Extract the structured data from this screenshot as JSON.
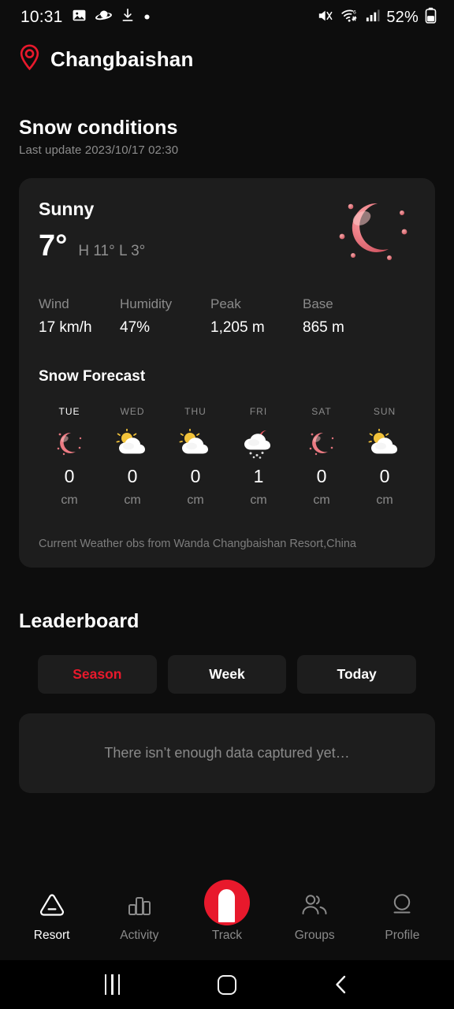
{
  "statusbar": {
    "time": "10:31",
    "battery_percent": "52%",
    "left_icons": [
      "image-icon",
      "saturn-icon",
      "download-icon",
      "dot-icon"
    ],
    "right_icons": [
      "mute-icon",
      "wifi-icon",
      "signal-icon",
      "battery-icon"
    ]
  },
  "header": {
    "location": "Changbaishan",
    "pin_icon": "location-pin-icon"
  },
  "snow": {
    "title": "Snow conditions",
    "last_update": "Last update 2023/10/17 02:30",
    "condition": "Sunny",
    "temperature": "7°",
    "high_low": "H 11°  L 3°",
    "weather_icon": "crescent-moon-icon",
    "stats": [
      {
        "label": "Wind",
        "value": "17 km/h"
      },
      {
        "label": "Humidity",
        "value": "47%"
      },
      {
        "label": "Peak",
        "value": "1,205 m"
      },
      {
        "label": "Base",
        "value": "865 m"
      }
    ],
    "forecast_title": "Snow Forecast",
    "forecast": [
      {
        "day": "TUE",
        "icon": "moon-icon",
        "value": "0",
        "unit": "cm",
        "active": true
      },
      {
        "day": "WED",
        "icon": "sun-cloud-icon",
        "value": "0",
        "unit": "cm",
        "active": false
      },
      {
        "day": "THU",
        "icon": "sun-cloud-icon",
        "value": "0",
        "unit": "cm",
        "active": false
      },
      {
        "day": "FRI",
        "icon": "snow-cloud-icon",
        "value": "1",
        "unit": "cm",
        "active": false
      },
      {
        "day": "SAT",
        "icon": "moon-icon",
        "value": "0",
        "unit": "cm",
        "active": false
      },
      {
        "day": "SUN",
        "icon": "sun-cloud-icon",
        "value": "0",
        "unit": "cm",
        "active": false
      }
    ],
    "obs_note": "Current Weather obs from Wanda Changbaishan Resort,China"
  },
  "leaderboard": {
    "title": "Leaderboard",
    "tabs": [
      {
        "label": "Season",
        "active": true
      },
      {
        "label": "Week",
        "active": false
      },
      {
        "label": "Today",
        "active": false
      }
    ],
    "empty_text": "There isn’t enough data captured yet…"
  },
  "bottomnav": [
    {
      "label": "Resort",
      "icon": "mountain-icon",
      "active": true
    },
    {
      "label": "Activity",
      "icon": "bar-chart-icon",
      "active": false
    },
    {
      "label": "Track",
      "icon": "track-icon",
      "active": false
    },
    {
      "label": "Groups",
      "icon": "people-icon",
      "active": false
    },
    {
      "label": "Profile",
      "icon": "person-icon",
      "active": false
    }
  ],
  "androidnav": {
    "recents": "recents-icon",
    "home": "home-icon",
    "back": "back-icon"
  },
  "colors": {
    "accent_red": "#e8192c",
    "background": "#0d0d0d",
    "card": "#1d1d1d",
    "muted_text": "#8a8a8a"
  }
}
